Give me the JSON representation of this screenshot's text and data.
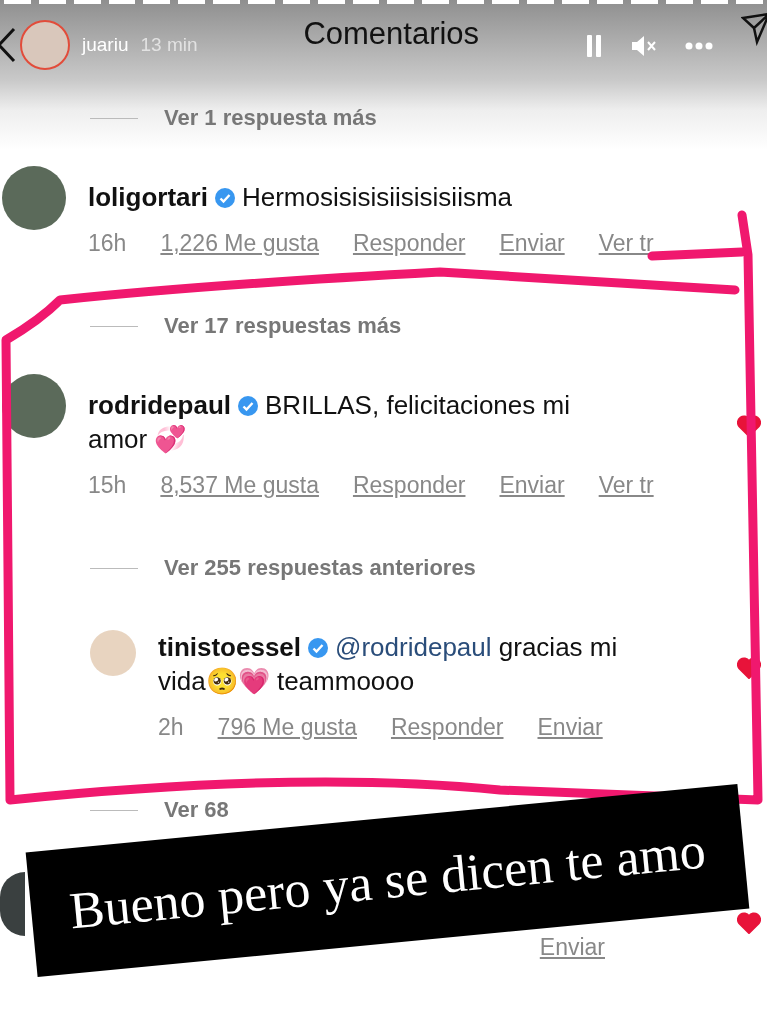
{
  "story": {
    "username": "juariu",
    "time": "13 min",
    "paused": true,
    "muted": true
  },
  "sheet": {
    "title": "Comentarios"
  },
  "items": [
    {
      "kind": "toggle",
      "label": "Ver 1 respuesta más"
    },
    {
      "kind": "comment",
      "reply": false,
      "username": "loligortari",
      "verified": true,
      "text": "Hermosisisisiisisisiisma",
      "time": "16h",
      "likes": "1,226 Me gusta",
      "actions": [
        "Responder",
        "Enviar",
        "Ver tr"
      ]
    },
    {
      "kind": "toggle",
      "label": "Ver 17 respuestas más"
    },
    {
      "kind": "comment",
      "reply": false,
      "username": "rodridepaul",
      "verified": true,
      "text": "BRILLAS, felicitaciones mi amor 💞",
      "time": "15h",
      "likes": "8,537 Me gusta",
      "actions": [
        "Responder",
        "Enviar",
        "Ver tr"
      ],
      "liked": true
    },
    {
      "kind": "toggle",
      "label": "Ver 255 respuestas anteriores"
    },
    {
      "kind": "comment",
      "reply": true,
      "username": "tinistoessel",
      "verified": true,
      "mention": "@rodridepaul",
      "text": "gracias mi vida🥺💗 teammoooo",
      "time": "2h",
      "likes": "796 Me gusta",
      "actions": [
        "Responder",
        "Enviar"
      ],
      "liked": true
    },
    {
      "kind": "toggle",
      "label": "Ver 68"
    },
    {
      "kind": "hidden_comment",
      "actions": [
        "Enviar"
      ],
      "liked": true
    }
  ],
  "sticker": {
    "text": "Bueno pero ya se dicen te amo"
  }
}
